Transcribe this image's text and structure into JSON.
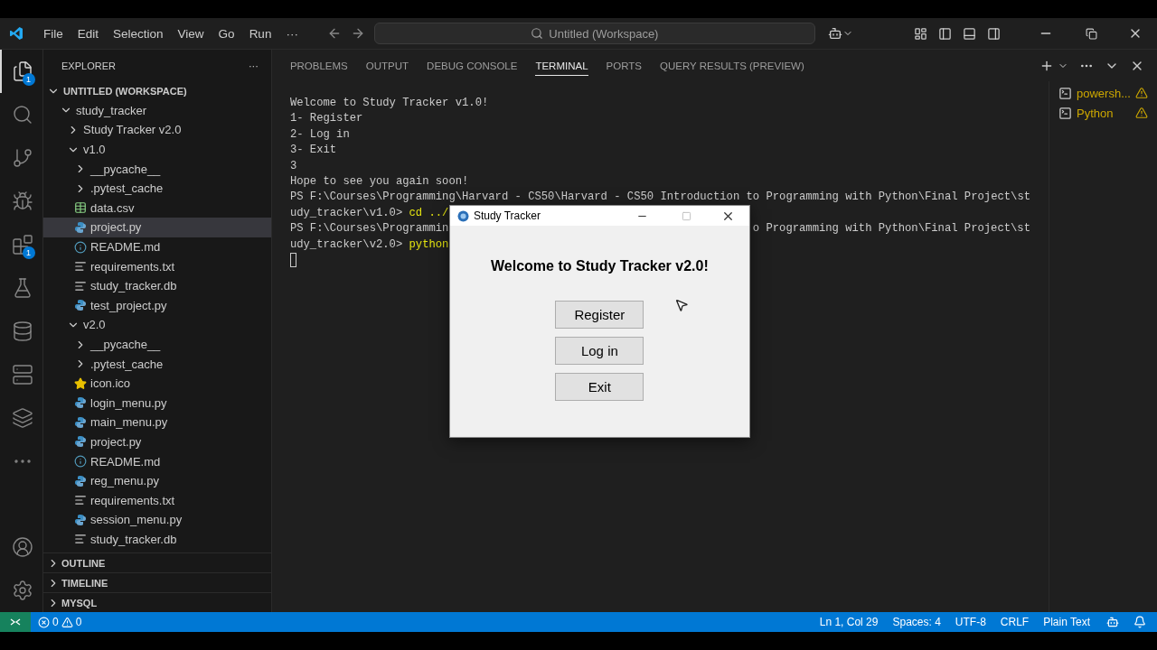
{
  "title_bar": {
    "menus": [
      "File",
      "Edit",
      "Selection",
      "View",
      "Go",
      "Run"
    ],
    "more": "···",
    "search": "Untitled (Workspace)"
  },
  "activity_bar": {
    "items": [
      {
        "kind": "explorer",
        "selected": true,
        "badge": "1"
      },
      {
        "kind": "search",
        "selected": false
      },
      {
        "kind": "source-control",
        "selected": false
      },
      {
        "kind": "run-debug",
        "selected": false
      },
      {
        "kind": "extensions",
        "selected": false,
        "badge": "1"
      },
      {
        "kind": "testing",
        "selected": false
      },
      {
        "kind": "database",
        "selected": false
      },
      {
        "kind": "remote",
        "selected": false
      },
      {
        "kind": "layers",
        "selected": false
      },
      {
        "kind": "more",
        "selected": false
      }
    ],
    "bottom": [
      {
        "kind": "account"
      },
      {
        "kind": "settings"
      }
    ]
  },
  "sidebar": {
    "title": "EXPLORER",
    "more": "···",
    "workspace": "UNTITLED (WORKSPACE)",
    "tree": [
      {
        "label": "study_tracker",
        "kind": "folder",
        "expanded": true,
        "selected": false,
        "children": [
          {
            "label": "Study Tracker v2.0",
            "kind": "folder",
            "expanded": false,
            "selected": false
          },
          {
            "label": "v1.0",
            "kind": "folder",
            "expanded": true,
            "selected": false,
            "children": [
              {
                "label": "__pycache__",
                "kind": "folder",
                "expanded": false,
                "selected": false
              },
              {
                "label": ".pytest_cache",
                "kind": "folder",
                "expanded": false,
                "selected": false
              },
              {
                "label": "data.csv",
                "kind": "csv",
                "selected": false
              },
              {
                "label": "project.py",
                "kind": "python",
                "selected": true
              },
              {
                "label": "README.md",
                "kind": "info",
                "selected": false
              },
              {
                "label": "requirements.txt",
                "kind": "text",
                "selected": false
              },
              {
                "label": "study_tracker.db",
                "kind": "text",
                "selected": false
              },
              {
                "label": "test_project.py",
                "kind": "python",
                "selected": false
              }
            ]
          },
          {
            "label": "v2.0",
            "kind": "folder",
            "expanded": true,
            "selected": false,
            "children": [
              {
                "label": "__pycache__",
                "kind": "folder",
                "expanded": false,
                "selected": false
              },
              {
                "label": ".pytest_cache",
                "kind": "folder",
                "expanded": false,
                "selected": false
              },
              {
                "label": "icon.ico",
                "kind": "star",
                "selected": false
              },
              {
                "label": "login_menu.py",
                "kind": "python",
                "selected": false
              },
              {
                "label": "main_menu.py",
                "kind": "python",
                "selected": false
              },
              {
                "label": "project.py",
                "kind": "python",
                "selected": false
              },
              {
                "label": "README.md",
                "kind": "info",
                "selected": false
              },
              {
                "label": "reg_menu.py",
                "kind": "python",
                "selected": false
              },
              {
                "label": "requirements.txt",
                "kind": "text",
                "selected": false
              },
              {
                "label": "session_menu.py",
                "kind": "python",
                "selected": false
              },
              {
                "label": "study_tracker.db",
                "kind": "text",
                "selected": false
              }
            ]
          }
        ]
      }
    ],
    "sections": [
      {
        "label": "OUTLINE",
        "expanded": false
      },
      {
        "label": "TIMELINE",
        "expanded": false
      },
      {
        "label": "MYSQL",
        "expanded": false
      }
    ]
  },
  "panel": {
    "tabs": [
      {
        "label": "PROBLEMS",
        "selected": false
      },
      {
        "label": "OUTPUT",
        "selected": false
      },
      {
        "label": "DEBUG CONSOLE",
        "selected": false
      },
      {
        "label": "TERMINAL",
        "selected": true
      },
      {
        "label": "PORTS",
        "selected": false
      },
      {
        "label": "QUERY RESULTS (PREVIEW)",
        "selected": false
      }
    ],
    "terminal": {
      "lines": [
        {
          "segments": [
            {
              "text": "Welcome to Study Tracker v1.0!"
            }
          ]
        },
        {
          "segments": [
            {
              "text": "1- Register"
            }
          ]
        },
        {
          "segments": [
            {
              "text": "2- Log in"
            }
          ]
        },
        {
          "segments": [
            {
              "text": "3- Exit"
            }
          ]
        },
        {
          "segments": [
            {
              "text": "3"
            }
          ]
        },
        {
          "segments": [
            {
              "text": "Hope to see you again soon!"
            }
          ]
        },
        {
          "segments": [
            {
              "text": "PS F:\\Courses\\Programming\\Harvard - CS50\\Harvard - CS50 Introduction to Programming with Python\\Final Project\\st"
            }
          ]
        },
        {
          "segments": [
            {
              "text": "udy_tracker\\v1.0> "
            },
            {
              "text": "cd ../",
              "kind": "command"
            }
          ]
        },
        {
          "segments": [
            {
              "text": "PS F:\\Courses\\Programmin"
            }
          ],
          "right": "o Programming with Python\\Final Project\\st"
        },
        {
          "segments": [
            {
              "text": "udy_tracker\\v2.0> "
            },
            {
              "text": "python",
              "kind": "command"
            }
          ]
        }
      ],
      "cursor_visible": true
    },
    "sessions": [
      {
        "label": "powersh...",
        "warning": true
      },
      {
        "label": "Python",
        "warning": true
      }
    ]
  },
  "dialog": {
    "title": "Study Tracker",
    "heading": "Welcome to Study Tracker v2.0!",
    "buttons": [
      "Register",
      "Log in",
      "Exit"
    ]
  },
  "status_bar": {
    "errors": "0",
    "warnings": "0",
    "right": [
      "Ln 1, Col 29",
      "Spaces: 4",
      "UTF-8",
      "CRLF",
      "Plain Text"
    ]
  }
}
